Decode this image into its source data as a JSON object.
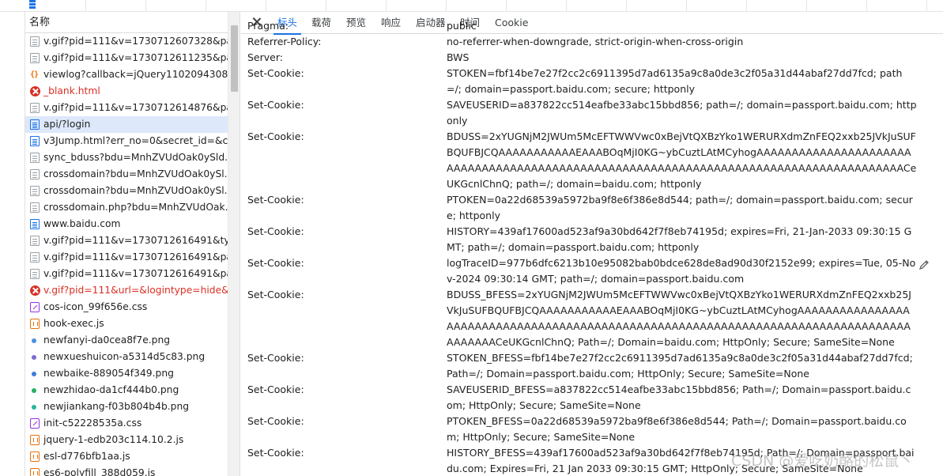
{
  "request_list": {
    "header": "名称",
    "items": [
      {
        "name": "v.gif?pid=111&v=1730712607328&pa...",
        "icon": "document-icon",
        "kind": "doc"
      },
      {
        "name": "v.gif?pid=111&v=1730712611235&pa...",
        "icon": "document-icon",
        "kind": "doc"
      },
      {
        "name": "viewlog?callback=jQuery11020943082...",
        "icon": "script-icon",
        "kind": "script"
      },
      {
        "name": "_blank.html",
        "icon": "error-icon",
        "kind": "err"
      },
      {
        "name": "v.gif?pid=111&v=1730712614876&pa...",
        "icon": "document-icon",
        "kind": "doc"
      },
      {
        "name": "api/?login",
        "icon": "html-document-icon",
        "kind": "html",
        "selected": true
      },
      {
        "name": "v3Jump.html?err_no=0&secret_id=&c...",
        "icon": "html-document-icon",
        "kind": "html"
      },
      {
        "name": "sync_bduss?bdu=MnhZVUdOak0ySld...",
        "icon": "document-icon",
        "kind": "doc"
      },
      {
        "name": "crossdomain?bdu=MnhZVUdOak0ySl...",
        "icon": "document-icon",
        "kind": "doc"
      },
      {
        "name": "crossdomain?bdu=MnhZVUdOak0ySl...",
        "icon": "document-icon",
        "kind": "doc"
      },
      {
        "name": "crossdomain.php?bdu=MnhZVUdOak...",
        "icon": "document-icon",
        "kind": "doc"
      },
      {
        "name": "www.baidu.com",
        "icon": "html-document-icon",
        "kind": "html"
      },
      {
        "name": "v.gif?pid=111&v=1730712616491&ty...",
        "icon": "document-icon",
        "kind": "doc"
      },
      {
        "name": "v.gif?pid=111&v=1730712616491&pa...",
        "icon": "document-icon",
        "kind": "doc"
      },
      {
        "name": "v.gif?pid=111&v=1730712616491&pa...",
        "icon": "document-icon",
        "kind": "doc"
      },
      {
        "name": "v.gif?pid=111&url=&logintype=hide&...",
        "icon": "error-icon",
        "kind": "err"
      },
      {
        "name": "cos-icon_99f656e.css",
        "icon": "stylesheet-icon",
        "kind": "css"
      },
      {
        "name": "hook-exec.js",
        "icon": "javascript-icon",
        "kind": "js"
      },
      {
        "name": "newfanyi-da0cea8f7e.png",
        "icon": "image-icon",
        "kind": "img",
        "color": "#4a90e2"
      },
      {
        "name": "newxueshuicon-a5314d5c83.png",
        "icon": "image-icon",
        "kind": "img",
        "color": "#7b6ccf"
      },
      {
        "name": "newbaike-889054f349.png",
        "icon": "image-icon",
        "kind": "img",
        "color": "#3b7ddd"
      },
      {
        "name": "newzhidao-da1cf444b0.png",
        "icon": "image-icon",
        "kind": "img",
        "color": "#27ae60"
      },
      {
        "name": "newjiankang-f03b804b4b.png",
        "icon": "image-icon",
        "kind": "img",
        "color": "#2bb5a0"
      },
      {
        "name": "init-c52228535a.css",
        "icon": "stylesheet-icon",
        "kind": "css"
      },
      {
        "name": "jquery-1-edb203c114.10.2.js",
        "icon": "javascript-icon",
        "kind": "js"
      },
      {
        "name": "esl-d776bfb1aa.js",
        "icon": "javascript-icon",
        "kind": "js"
      },
      {
        "name": "es6-polyfill_388d059.js",
        "icon": "javascript-icon",
        "kind": "js"
      }
    ]
  },
  "tabs": [
    {
      "label": "标头",
      "active": true
    },
    {
      "label": "载荷"
    },
    {
      "label": "预览"
    },
    {
      "label": "响应"
    },
    {
      "label": "启动器"
    },
    {
      "label": "时间"
    },
    {
      "label": "Cookie"
    }
  ],
  "headers": [
    {
      "name": "Pragma:",
      "value": "public"
    },
    {
      "name": "Referrer-Policy:",
      "value": "no-referrer-when-downgrade, strict-origin-when-cross-origin"
    },
    {
      "name": "Server:",
      "value": "BWS"
    },
    {
      "name": "Set-Cookie:",
      "value": "STOKEN=fbf14be7e27f2cc2c6911395d7ad6135a9c8a0de3c2f05a31d44abaf27dd7fcd; path=/; domain=passport.baidu.com; secure; httponly"
    },
    {
      "name": "Set-Cookie:",
      "value": "SAVEUSERID=a837822cc514eafbe33abc15bbd856; path=/; domain=passport.baidu.com; httponly"
    },
    {
      "name": "Set-Cookie:",
      "value": "BDUSS=2xYUGNjM2JWUm5McEFTWWVwc0xBejVtQXBzYko1WERURXdmZnFEQ2xxb25JVkJuSUFBQUFBJCQAAAAAAAAAAAEAAABOqMjI0KG~ybCuztLAtMCyhogAAAAAAAAAAAAAAAAAAAAAAAAAAAAAAAAAAAAAAAAAAAAAAAAAAAAAAAAAAAAAAAAAAAAAAAAAAAAAAAAAAAAAAACeUKGcnlChnQ; path=/; domain=baidu.com; httponly"
    },
    {
      "name": "Set-Cookie:",
      "value": "PTOKEN=0a22d68539a5972ba9f8e6f386e8d544; path=/; domain=passport.baidu.com; secure; httponly"
    },
    {
      "name": "Set-Cookie:",
      "value": "HISTORY=439af17600ad523af9a30bd642f7f8eb74195d; expires=Fri, 21-Jan-2033 09:30:15 GMT; path=/; domain=passport.baidu.com; httponly"
    },
    {
      "name": "Set-Cookie:",
      "value": "logTraceID=977b6dfc6213b10e95082bab0bdce628de8ad90d30f2152e99; expires=Tue, 05-Nov-2024 09:30:14 GMT; path=/; domain=passport.baidu.com"
    },
    {
      "name": "Set-Cookie:",
      "value": "BDUSS_BFESS=2xYUGNjM2JWUm5McEFTWWVwc0xBejVtQXBzYko1WERURXdmZnFEQ2xxb25JVkJuSUFBQUFBJCQAAAAAAAAAAAEAAABOqMjI0KG~ybCuztLAtMCyhogAAAAAAAAAAAAAAAAAAAAAAAAAAAAAAAAAAAAAAAAAAAAAAAAAAAAAAAAAAAAAAAAAAAAAAAAAAAAAAAAAAAAAAAAACeUKGcnlChnQ; Path=/; Domain=baidu.com; HttpOnly; Secure; SameSite=None"
    },
    {
      "name": "Set-Cookie:",
      "value": "STOKEN_BFESS=fbf14be7e27f2cc2c6911395d7ad6135a9c8a0de3c2f05a31d44abaf27dd7fcd; Path=/; Domain=passport.baidu.com; HttpOnly; Secure; SameSite=None"
    },
    {
      "name": "Set-Cookie:",
      "value": "SAVEUSERID_BFESS=a837822cc514eafbe33abc15bbd856; Path=/; Domain=passport.baidu.com; HttpOnly; Secure; SameSite=None"
    },
    {
      "name": "Set-Cookie:",
      "value": "PTOKEN_BFESS=0a22d68539a5972ba9f8e6f386e8d544; Path=/; Domain=passport.baidu.com; HttpOnly; Secure; SameSite=None"
    },
    {
      "name": "Set-Cookie:",
      "value": "HISTORY_BFESS=439af17600ad523af9a30bd642f7f8eb74195d; Path=/; Domain=passport.baidu.com; Expires=Fri, 21 Jan 2033 09:30:15 GMT; HttpOnly; Secure; SameSite=None"
    }
  ],
  "watermark": "CSDN @爱吃奶酪的松鼠丶",
  "colors": {
    "accent": "#1a73e8",
    "selected_row": "#dde8fb",
    "error": "#d93025"
  }
}
